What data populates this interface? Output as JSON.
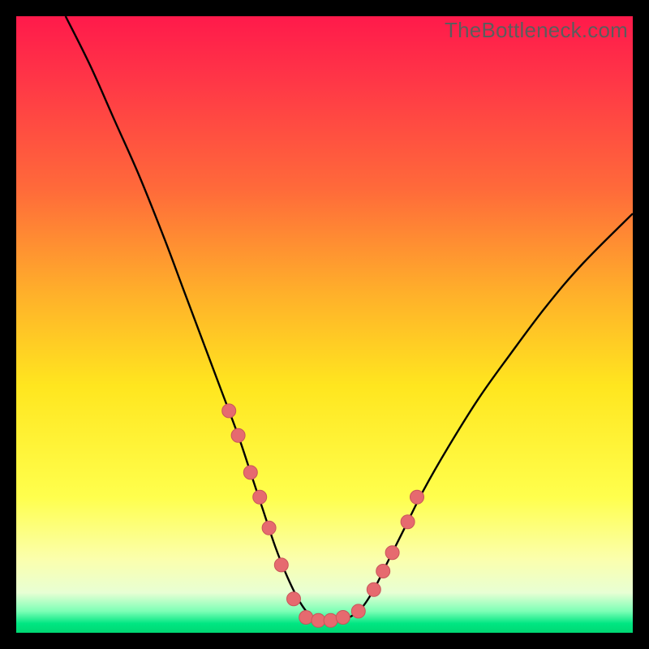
{
  "watermark": "TheBottleneck.com",
  "colors": {
    "black": "#000000",
    "curve": "#000000",
    "marker_fill": "#e66a6f",
    "marker_stroke": "#c9555a",
    "gradient_stops": [
      {
        "offset": 0.0,
        "color": "#ff1a4b"
      },
      {
        "offset": 0.1,
        "color": "#ff3547"
      },
      {
        "offset": 0.28,
        "color": "#ff6a3a"
      },
      {
        "offset": 0.45,
        "color": "#ffb02a"
      },
      {
        "offset": 0.6,
        "color": "#ffe61f"
      },
      {
        "offset": 0.78,
        "color": "#ffff4d"
      },
      {
        "offset": 0.88,
        "color": "#fbffac"
      },
      {
        "offset": 0.935,
        "color": "#e8ffd4"
      },
      {
        "offset": 0.965,
        "color": "#7dffb6"
      },
      {
        "offset": 0.985,
        "color": "#00e682"
      },
      {
        "offset": 1.0,
        "color": "#00d873"
      }
    ]
  },
  "chart_data": {
    "type": "line",
    "title": "",
    "xlabel": "",
    "ylabel": "",
    "xlim": [
      0,
      100
    ],
    "ylim": [
      0,
      100
    ],
    "series": [
      {
        "name": "bottleneck-curve",
        "x": [
          8,
          12,
          16,
          20,
          24,
          27,
          30,
          33,
          36,
          38,
          40,
          42,
          44,
          46,
          48,
          50,
          52,
          54,
          56,
          58,
          60,
          63,
          66,
          70,
          75,
          80,
          86,
          92,
          100
        ],
        "y": [
          100,
          92,
          83,
          74,
          64,
          56,
          48,
          40,
          32,
          26,
          20,
          14,
          9,
          5,
          2.5,
          2,
          2,
          2.5,
          4,
          7,
          11,
          17,
          23,
          30,
          38,
          45,
          53,
          60,
          68
        ]
      }
    ],
    "markers": {
      "name": "highlight-dots",
      "x": [
        34.5,
        36,
        38,
        39.5,
        41,
        43,
        45,
        47,
        49,
        51,
        53,
        55.5,
        58,
        59.5,
        61,
        63.5,
        65
      ],
      "y": [
        36,
        32,
        26,
        22,
        17,
        11,
        5.5,
        2.5,
        2,
        2,
        2.5,
        3.5,
        7,
        10,
        13,
        18,
        22
      ]
    }
  }
}
